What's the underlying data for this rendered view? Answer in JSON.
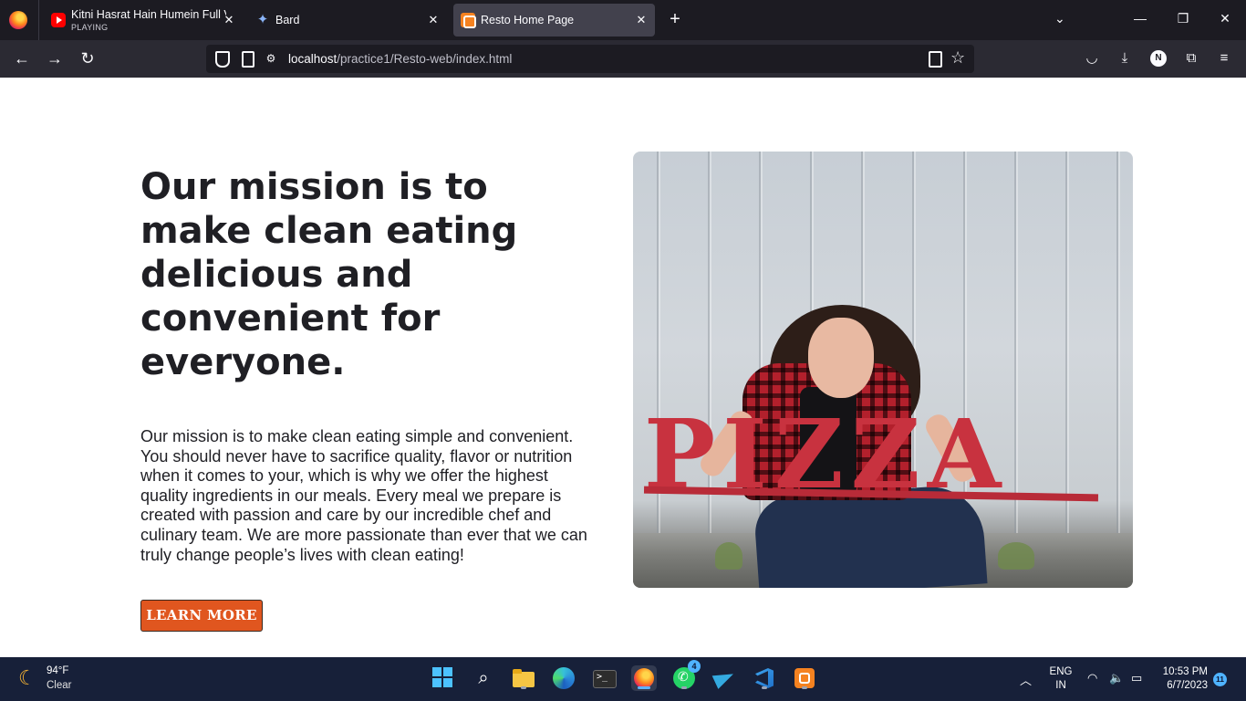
{
  "browser": {
    "tabs": [
      {
        "title": "Kitni Hasrat Hain Humein Full Video",
        "status": "PLAYING",
        "icon": "youtube-icon"
      },
      {
        "title": "Bard",
        "icon": "bard-icon"
      },
      {
        "title": "Resto Home Page",
        "icon": "xampp-icon",
        "active": true
      }
    ],
    "url_host": "localhost",
    "url_path": "/practice1/Resto-web/index.html",
    "profile_initial": "N"
  },
  "page": {
    "headline": "Our mission is to make clean eating delicious and convenient for everyone.",
    "paragraph": "Our mission is to make clean eating simple and convenient. You should never have to sacrifice quality, flavor or nutrition when it comes to your, which is why we offer the highest quality ingredients in our meals. Every meal we prepare is created with passion and care by our incredible chef and culinary team. We are more passionate than ever that we can truly change people’s lives with clean eating!",
    "button_label": "LEARN MORE",
    "button_color": "#e0561f",
    "hero_sign_text": "PIZZA"
  },
  "taskbar": {
    "weather_temp": "94°F",
    "weather_condition": "Clear",
    "whatsapp_badge": "4",
    "lang_line1": "ENG",
    "lang_line2": "IN",
    "time": "10:53 PM",
    "date": "6/7/2023",
    "notification_count": "11"
  }
}
